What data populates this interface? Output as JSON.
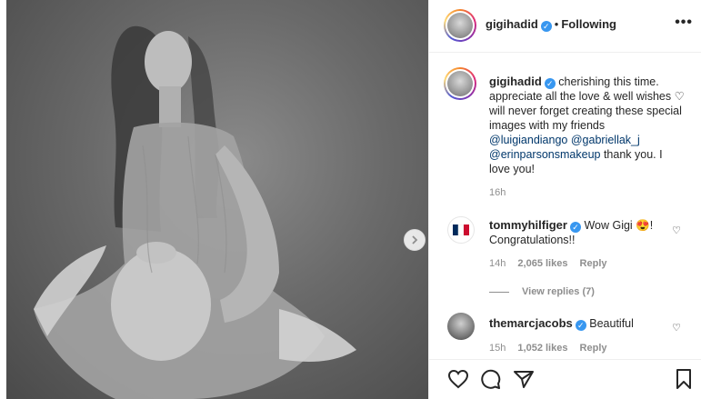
{
  "post": {
    "username": "gigihadid",
    "follow_status": "Following",
    "more_label": "•••"
  },
  "caption": {
    "username": "gigihadid",
    "line1": "cherishing this time.",
    "line2": "appreciate all the love & well wishes ♡",
    "line3": "will never forget creating these special",
    "line4": "images with my friends",
    "mention1": "@luigiandiango",
    "mention2": "@gabriellak_j",
    "mention3": "@erinparsonsmakeup",
    "tail": " thank you. I",
    "last_line": "love you!",
    "time": "16h"
  },
  "comments": [
    {
      "username": "tommyhilfiger",
      "text_line1": "Wow Gigi 😍!",
      "text_line2": "Congratulations!!",
      "time": "14h",
      "likes": "2,065 likes",
      "reply": "Reply",
      "view_replies": "View replies (7)"
    },
    {
      "username": "themarcjacobs",
      "text_line1": "Beautiful",
      "time": "15h",
      "likes": "1,052 likes",
      "reply": "Reply"
    }
  ],
  "colors": {
    "verified": "#3897f0",
    "mention": "#00376b",
    "muted": "#8e8e8e"
  },
  "icons": [
    "next-arrow-icon",
    "verified-icon",
    "more-icon",
    "heart-icon",
    "comment-icon",
    "share-icon",
    "bookmark-icon"
  ]
}
